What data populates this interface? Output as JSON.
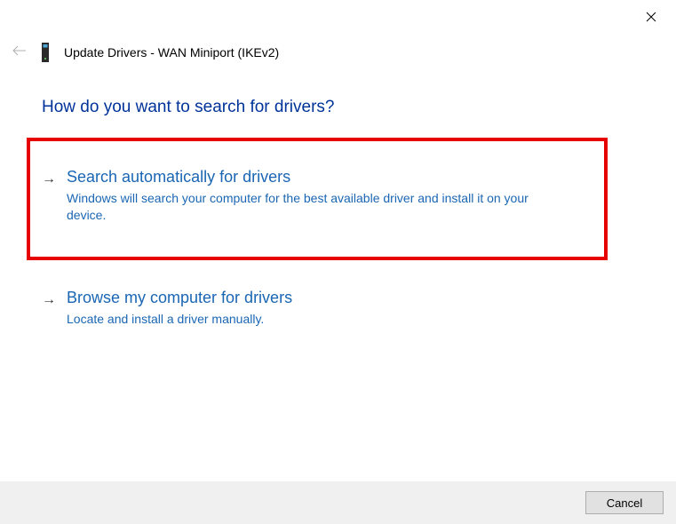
{
  "dialog": {
    "title": "Update Drivers - WAN Miniport (IKEv2)"
  },
  "heading": "How do you want to search for drivers?",
  "options": {
    "auto": {
      "title": "Search automatically for drivers",
      "desc": "Windows will search your computer for the best available driver and install it on your device."
    },
    "browse": {
      "title": "Browse my computer for drivers",
      "desc": "Locate and install a driver manually."
    }
  },
  "buttons": {
    "cancel": "Cancel"
  }
}
